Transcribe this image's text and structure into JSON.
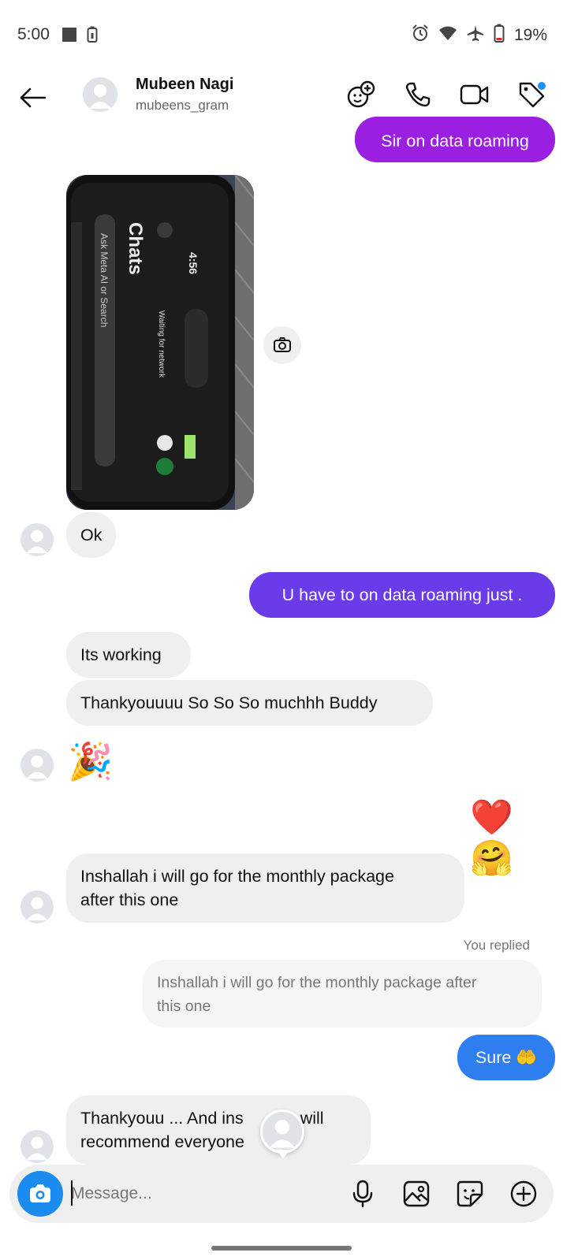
{
  "status_bar": {
    "time": "5:00",
    "battery_percent": "19%",
    "icons": [
      "square-notification-icon",
      "battery-saver-icon",
      "alarm-icon",
      "wifi-icon",
      "airplane-mode-icon",
      "battery-icon"
    ]
  },
  "header": {
    "name": "Mubeen Nagi",
    "handle": "mubeens_gram",
    "actions": [
      "add-effects-icon",
      "audio-call-icon",
      "video-call-icon",
      "tag-icon"
    ]
  },
  "messages": {
    "m1": "Sir on data roaming",
    "m3": "Ok",
    "m4": "U have to on data roaming just .",
    "m5": "Its working",
    "m6": "Thankyouuuu So So So muchhh Buddy",
    "m7_emoji": "🎉",
    "m8_emoji": "❤️ 🤗",
    "m9_line1": "Inshallah i will go for the monthly package",
    "m9_line2": "after this one",
    "you_replied": "You replied",
    "reply_quote_line1": "Inshallah i will go for the monthly package after",
    "reply_quote_line2": "this one",
    "m10": "Sure 🤲",
    "m11_line1": "Thankyouu ... And ins",
    "m11_line1_end": "h will",
    "m11_line2": "recommend everyone"
  },
  "photo": {
    "screen_time": "4:56",
    "screen_title": "Chats",
    "screen_status": "Waiting for network",
    "screen_search": "Ask Meta AI or Search"
  },
  "composer": {
    "placeholder": "Message..."
  },
  "colors": {
    "purple_bubble": "#9b1fe0",
    "indigo_bubble": "#6a3be8",
    "blue_bubble": "#2f7ef0",
    "incoming_bubble": "#efefef",
    "camera_button": "#1a8cf0"
  }
}
